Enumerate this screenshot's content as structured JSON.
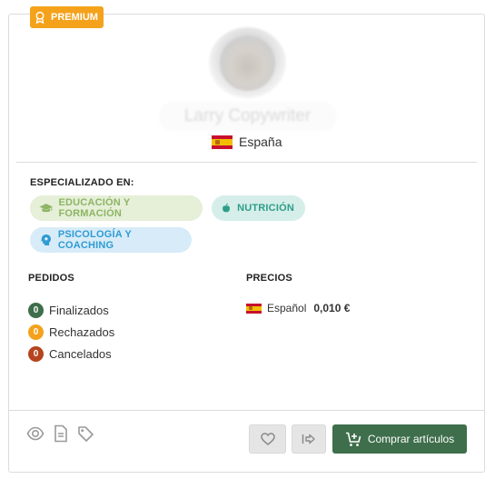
{
  "badge": {
    "label": "PREMIUM",
    "icon": "award-icon",
    "color": "#f4a21c"
  },
  "profile": {
    "name": "Larry Copywriter",
    "country": "España",
    "country_flag": "spain-flag-icon"
  },
  "specialized": {
    "title": "ESPECIALIZADO EN:",
    "tags": [
      {
        "label": "EDUCACIÓN Y FORMACIÓN",
        "icon": "graduation-cap-icon",
        "color": "#8db564"
      },
      {
        "label": "NUTRICIÓN",
        "icon": "apple-icon",
        "color": "#2f9d8a"
      },
      {
        "label": "PSICOLOGÍA Y COACHING",
        "icon": "head-icon",
        "color": "#2f9bd3"
      }
    ]
  },
  "orders": {
    "title": "PEDIDOS",
    "rows": [
      {
        "count": "0",
        "label": "Finalizados",
        "color": "#3e6e4b"
      },
      {
        "count": "0",
        "label": "Rechazados",
        "color": "#f4a21c"
      },
      {
        "count": "0",
        "label": "Cancelados",
        "color": "#b5441f"
      }
    ]
  },
  "prices": {
    "title": "PRECIOS",
    "rows": [
      {
        "language": "Español",
        "value": "0,010 €"
      }
    ]
  },
  "footer": {
    "icons": [
      "eye-icon",
      "document-icon",
      "tag-icon"
    ],
    "buy_label": "Comprar artículos",
    "buy_color": "#3e6e4b"
  }
}
